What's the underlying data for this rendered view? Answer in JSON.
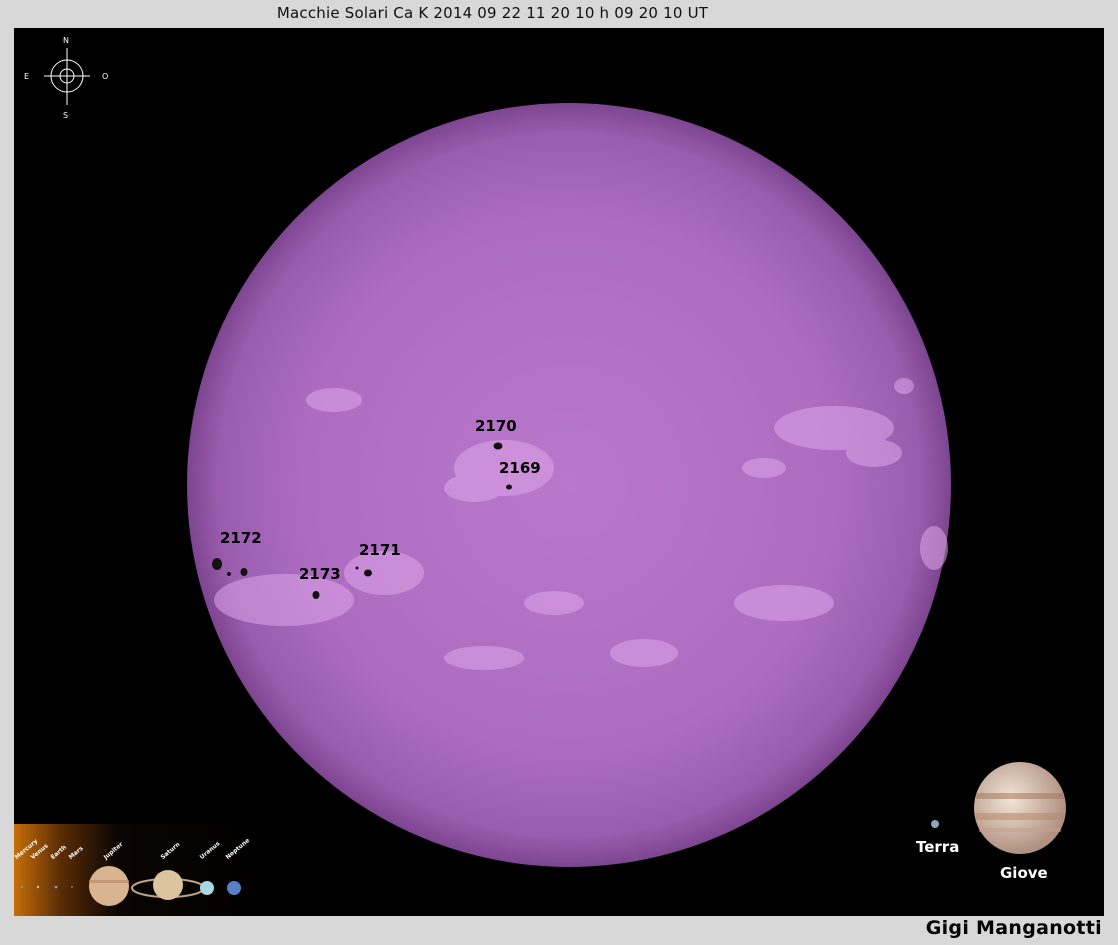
{
  "title": "Macchie Solari Ca K 2014 09 22 11 20 10 h 09 20 10 UT",
  "credit": "Gigi Manganotti",
  "compass": {
    "north": "N",
    "south": "S",
    "east": "E",
    "west": "O"
  },
  "sunspots": [
    {
      "id": "2170"
    },
    {
      "id": "2169"
    },
    {
      "id": "2172"
    },
    {
      "id": "2171"
    },
    {
      "id": "2173"
    }
  ],
  "planet_strip": [
    "Mercury",
    "Venus",
    "Earth",
    "Mars",
    "Jupiter",
    "Saturn",
    "Uranus",
    "Neptune"
  ],
  "comparison": {
    "earth_label": "Terra",
    "jupiter_label": "Giove"
  },
  "colors": {
    "sun": "#b26fc4",
    "sun_limb": "#8a4e9e",
    "plage": "#e2a8ec",
    "background": "#000000",
    "border": "#d8d8d8"
  }
}
